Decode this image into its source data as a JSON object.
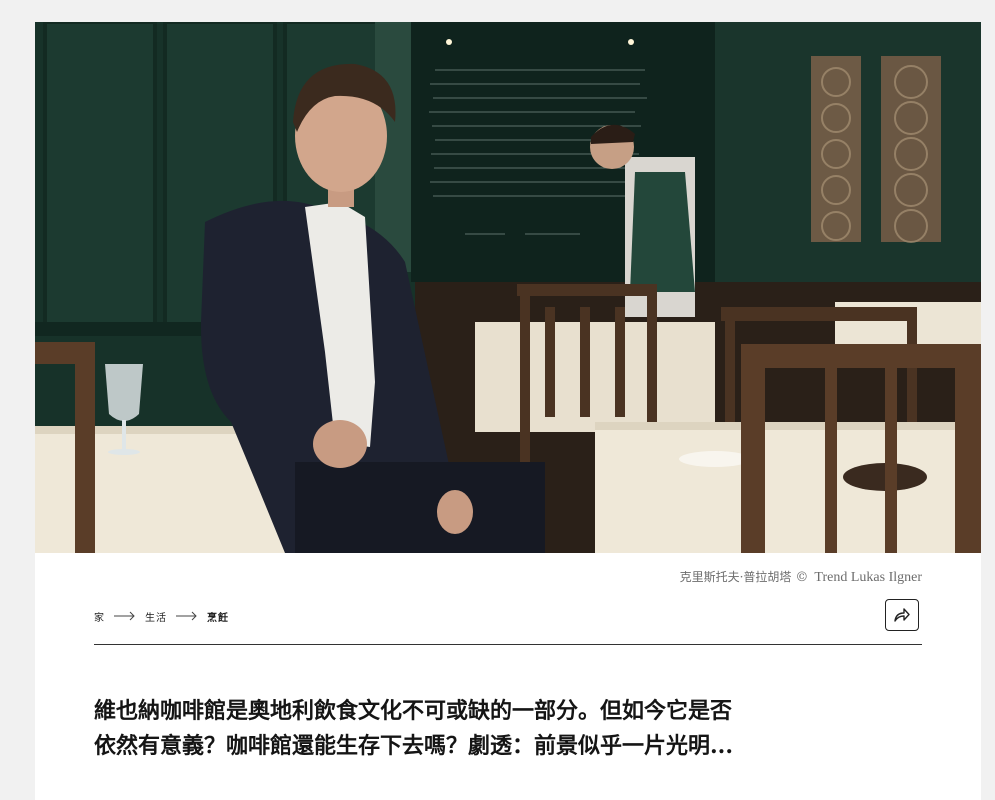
{
  "hero": {
    "kind": "photo",
    "alt_subject": "man in pinstripe suit seated at a table in a green-walled Viennese coffee house, waiter setting a table in background"
  },
  "photo_credit": {
    "names": "克里斯托夫·普拉胡塔",
    "symbol": "©",
    "agency": "Trend Lukas Ilgner"
  },
  "breadcrumb": {
    "items": [
      "家",
      "生活",
      "烹飪"
    ]
  },
  "share": {
    "icon": "share-arrow-icon"
  },
  "article": {
    "lead_line1": "維也納咖啡館是奧地利飲食文化不可或缺的一部分。但如今它是否",
    "lead_line2": "依然有意義？咖啡館還能生存下去嗎？劇透：前景似乎一片光明..."
  },
  "colors": {
    "page_bg": "#f1f1f1",
    "card_bg": "#ffffff",
    "wall_green": "#1f3d33",
    "text": "#151515"
  }
}
